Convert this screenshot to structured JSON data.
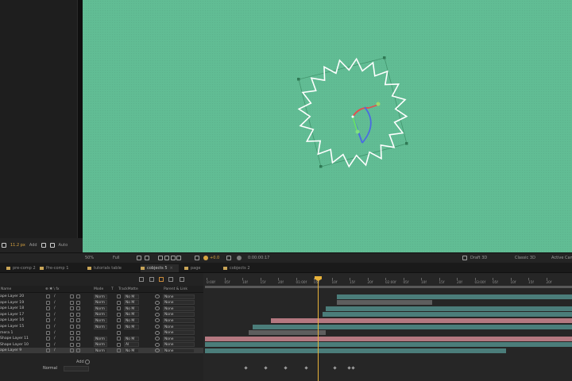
{
  "left_toolbar": {
    "value": "11.2 px",
    "add_label": "Add",
    "auto_label": "Auto"
  },
  "viewer_toolbar": {
    "zoom": "50%",
    "resolution": "Full",
    "exposure": "+0.0",
    "timecode": "0:00:00:17",
    "renderer": "Draft 3D",
    "view_mode": "Classic 3D",
    "active_camera": "Active Camera"
  },
  "tabs": [
    {
      "label": "pre-comp 2",
      "active": false
    },
    {
      "label": "Pre-comp 1",
      "active": false
    },
    {
      "label": "tutorials table",
      "active": false
    },
    {
      "label": "cobjects 5",
      "active": true
    },
    {
      "label": "page",
      "active": false
    },
    {
      "label": "cobjects 2",
      "active": false
    }
  ],
  "columns": {
    "name": "Name",
    "mode": "Mode",
    "t": "T",
    "trkmat": "TrackMatte",
    "parent": "Parent & Link"
  },
  "layers": [
    {
      "name": "ape Layer 20",
      "mode": "Norm",
      "trkmat": "No M",
      "parent": "None"
    },
    {
      "name": "ape Layer 19",
      "mode": "Norm",
      "trkmat": "No M",
      "parent": "None"
    },
    {
      "name": "ape Layer 18",
      "mode": "Norm",
      "trkmat": "No M",
      "parent": "None"
    },
    {
      "name": "ape Layer 17",
      "mode": "Norm",
      "trkmat": "No M",
      "parent": "None"
    },
    {
      "name": "ape Layer 16",
      "mode": "Norm",
      "trkmat": "No M",
      "parent": "None"
    },
    {
      "name": "ape Layer 15",
      "mode": "Norm",
      "trkmat": "No M",
      "parent": "None"
    },
    {
      "name": "mera 1",
      "mode": "",
      "trkmat": "",
      "parent": "None"
    },
    {
      "name": "Shape Layer 11",
      "mode": "Norm",
      "trkmat": "No M",
      "parent": "None"
    },
    {
      "name": "Shape Layer 10",
      "mode": "Norm",
      "trkmat": "Al",
      "parent": "None"
    },
    {
      "name": "ape Layer 9",
      "mode": "Norm",
      "trkmat": "No M",
      "parent": "None"
    }
  ],
  "add_label": "Add",
  "blend_mode": "Normal",
  "ruler_ticks": [
    "0:00f",
    "05f",
    "10f",
    "15f",
    "20f",
    "01:00f",
    "05f",
    "10f",
    "15f",
    "20f",
    "02:00f",
    "05f",
    "10f",
    "15f",
    "20f",
    "03:00f",
    "05f",
    "10f",
    "15f",
    "20f"
  ],
  "colors": {
    "comp_bg": "#61bd94",
    "playhead": "#e8b23a",
    "bar_teal": "#4b7d7a",
    "bar_pink": "#b47880",
    "bar_gray": "#5e5e5e"
  },
  "bars": [
    {
      "start": 0.36,
      "end": 1.0,
      "color": "teal"
    },
    {
      "start": 0.36,
      "end": 0.62,
      "color": "gray"
    },
    {
      "start": 0.33,
      "end": 1.0,
      "color": "teal"
    },
    {
      "start": 0.32,
      "end": 1.0,
      "color": "teal"
    },
    {
      "start": 0.18,
      "end": 1.0,
      "color": "pink"
    },
    {
      "start": 0.13,
      "end": 1.0,
      "color": "teal"
    },
    {
      "start": 0.12,
      "end": 0.33,
      "color": "gray"
    },
    {
      "start": 0.0,
      "end": 1.0,
      "color": "pink"
    },
    {
      "start": 0.0,
      "end": 1.0,
      "color": "teal"
    },
    {
      "start": 0.0,
      "end": 0.82,
      "color": "teal"
    }
  ]
}
